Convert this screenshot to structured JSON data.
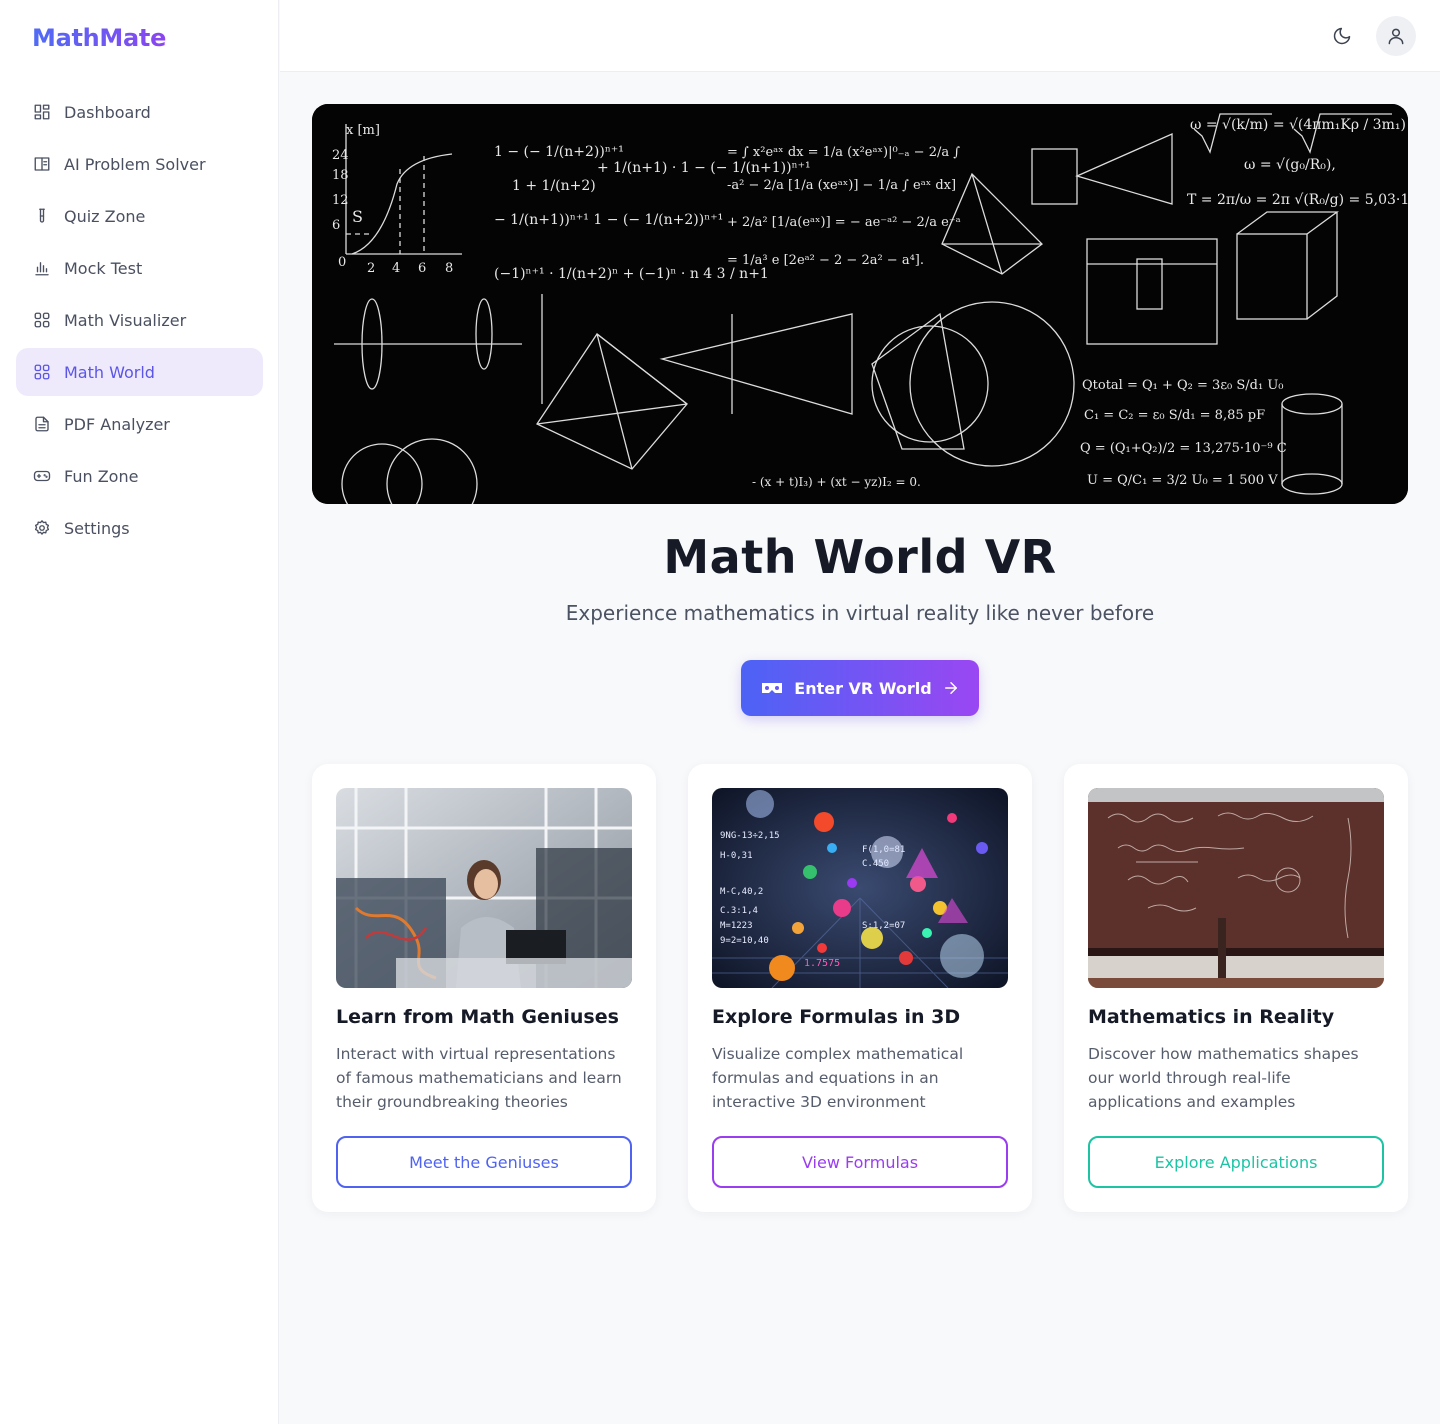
{
  "brand": {
    "name": "MathMate"
  },
  "sidebar": {
    "items": [
      {
        "label": "Dashboard",
        "icon": "dashboard-icon"
      },
      {
        "label": "AI Problem Solver",
        "icon": "book-icon"
      },
      {
        "label": "Quiz Zone",
        "icon": "test-tube-icon"
      },
      {
        "label": "Mock Test",
        "icon": "bar-chart-icon"
      },
      {
        "label": "Math Visualizer",
        "icon": "grid-icon"
      },
      {
        "label": "Math World",
        "icon": "grid-icon",
        "active": true
      },
      {
        "label": "PDF Analyzer",
        "icon": "file-text-icon"
      },
      {
        "label": "Fun Zone",
        "icon": "gamepad-icon"
      },
      {
        "label": "Settings",
        "icon": "gear-icon"
      }
    ]
  },
  "header": {
    "theme_icon": "moon-icon",
    "user_icon": "user-icon"
  },
  "main": {
    "title": "Math World VR",
    "subtitle": "Experience mathematics in virtual reality like never before",
    "cta_label": "Enter VR World",
    "cards": [
      {
        "title": "Learn from Math Geniuses",
        "description": "Interact with virtual representations of famous mathematicians and learn their groundbreaking theories",
        "button": "Meet the Geniuses",
        "accent": "#4f63f0"
      },
      {
        "title": "Explore Formulas in 3D",
        "description": "Visualize complex mathematical formulas and equations in an interactive 3D environment",
        "button": "View Formulas",
        "accent": "#9a3cf0"
      },
      {
        "title": "Mathematics in Reality",
        "description": "Discover how mathematics shapes our world through real-life applications and examples",
        "button": "Explore Applications",
        "accent": "#1cc4a4"
      }
    ]
  },
  "colors": {
    "brand_start": "#4f6cf5",
    "brand_end": "#8b45f0",
    "active_bg": "#eeeafc",
    "active_text": "#5b55e8"
  }
}
